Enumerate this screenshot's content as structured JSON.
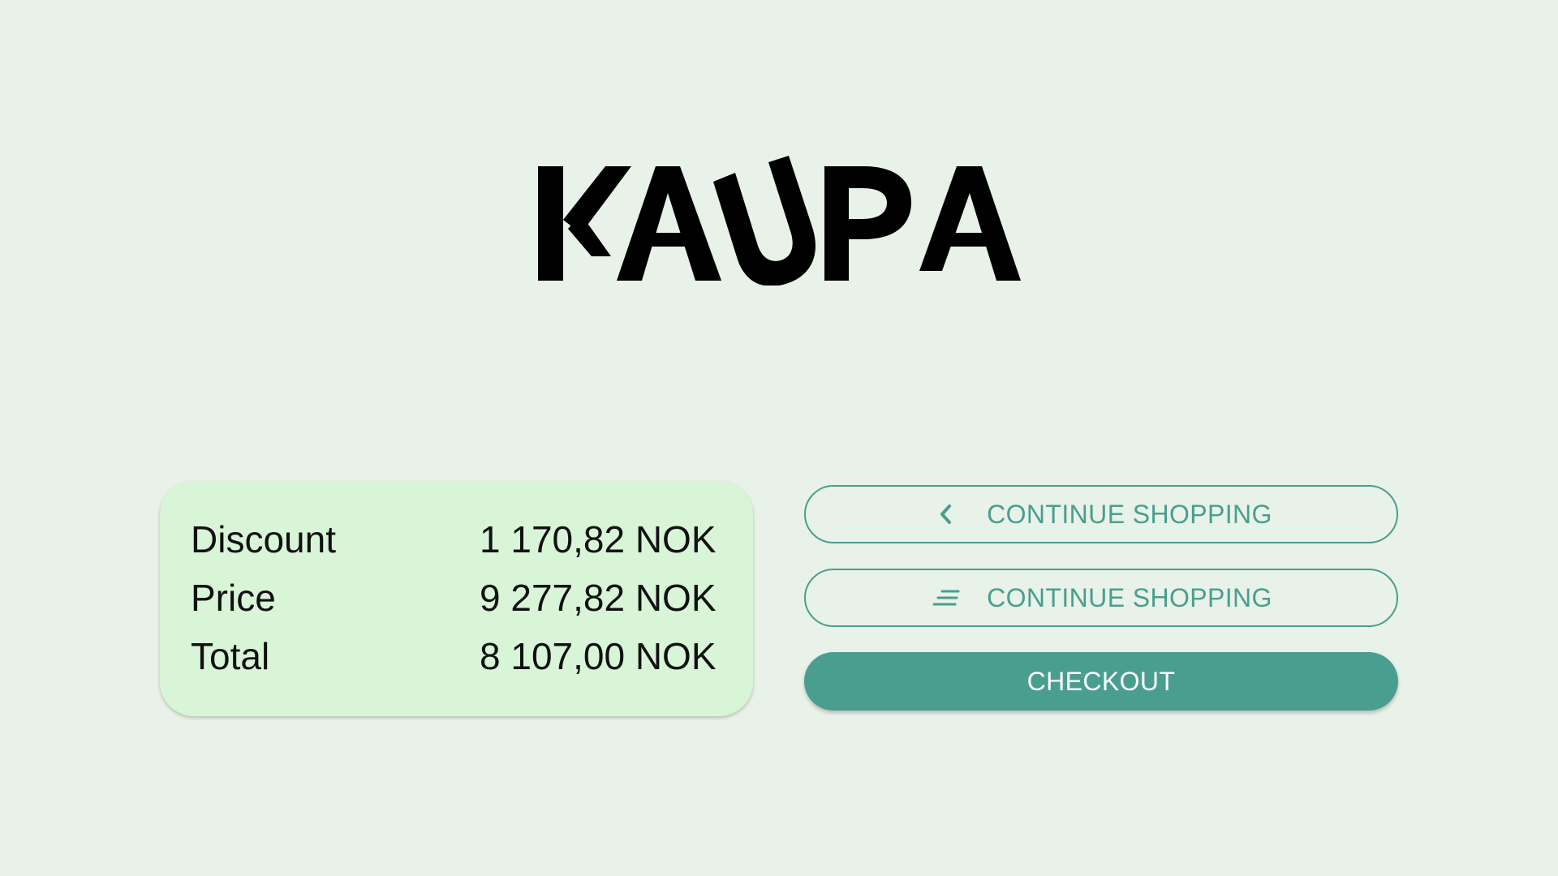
{
  "brand": {
    "logo_text": "KAUPA",
    "logo_color": "#000000"
  },
  "summary": {
    "rows": [
      {
        "label": "Discount",
        "value": "1 170,82 NOK"
      },
      {
        "label": "Price",
        "value": "9 277,82 NOK"
      },
      {
        "label": "Total",
        "value": "8 107,00 NOK"
      }
    ]
  },
  "actions": {
    "continue_shopping_back": {
      "label": "CONTINUE SHOPPING",
      "icon": "chevron-left-icon"
    },
    "continue_shopping_menu": {
      "label": "CONTINUE SHOPPING",
      "icon": "lines-icon"
    },
    "checkout": {
      "label": "CHECKOUT"
    }
  },
  "colors": {
    "background": "#e8f2e8",
    "card": "#d8f5d8",
    "accent": "#4a9e90",
    "on_accent": "#ffffff"
  }
}
